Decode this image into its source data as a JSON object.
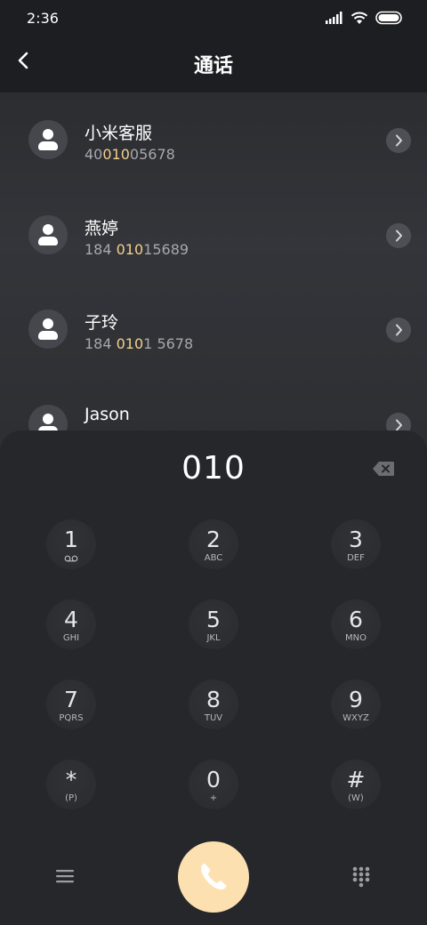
{
  "status": {
    "time": "2:36",
    "icons": [
      "signal-icon",
      "wifi-icon",
      "battery-icon"
    ]
  },
  "header": {
    "title": "通话",
    "back_icon": "back-chevron-icon"
  },
  "contacts": [
    {
      "name": "小米客服",
      "number_pre": "40",
      "number_hl": "010",
      "number_post": "05678"
    },
    {
      "name": "燕婷",
      "number_pre": "184 ",
      "number_hl": "010",
      "number_post": "15689"
    },
    {
      "name": "子玲",
      "number_pre": "184 ",
      "number_hl": "010",
      "number_post": "1 5678"
    },
    {
      "name": "Jason",
      "number_pre": "",
      "number_hl": "",
      "number_post": ""
    }
  ],
  "dialpad": {
    "display": "010",
    "keys": [
      {
        "digit": "1",
        "letters": "voicemail-icon"
      },
      {
        "digit": "2",
        "letters": "ABC"
      },
      {
        "digit": "3",
        "letters": "DEF"
      },
      {
        "digit": "4",
        "letters": "GHI"
      },
      {
        "digit": "5",
        "letters": "JKL"
      },
      {
        "digit": "6",
        "letters": "MNO"
      },
      {
        "digit": "7",
        "letters": "PQRS"
      },
      {
        "digit": "8",
        "letters": "TUV"
      },
      {
        "digit": "9",
        "letters": "WXYZ"
      },
      {
        "digit": "*",
        "letters": "(P)"
      },
      {
        "digit": "0",
        "letters": "+"
      },
      {
        "digit": "#",
        "letters": "(W)"
      }
    ]
  },
  "colors": {
    "highlight": "#f3cf8c",
    "call_button": "#fde0b0",
    "background": "#1f2023",
    "dialpad": "#26272b"
  }
}
